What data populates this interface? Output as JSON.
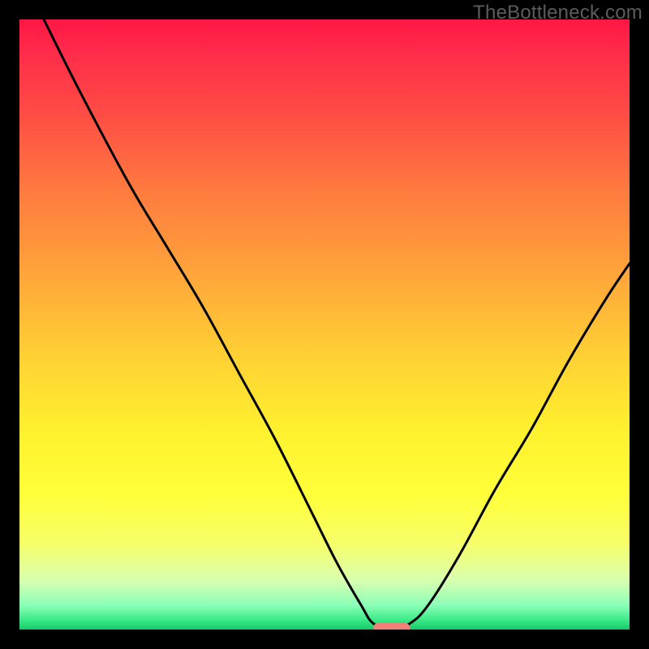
{
  "watermark": "TheBottleneck.com",
  "chart_data": {
    "type": "line",
    "title": "",
    "xlabel": "",
    "ylabel": "",
    "xlim": [
      0,
      100
    ],
    "ylim": [
      0,
      100
    ],
    "curve": [
      {
        "x": 4,
        "y": 100
      },
      {
        "x": 10,
        "y": 88
      },
      {
        "x": 18,
        "y": 73
      },
      {
        "x": 24,
        "y": 63
      },
      {
        "x": 30,
        "y": 53
      },
      {
        "x": 36,
        "y": 42
      },
      {
        "x": 42,
        "y": 31
      },
      {
        "x": 48,
        "y": 19
      },
      {
        "x": 52,
        "y": 11
      },
      {
        "x": 56,
        "y": 4
      },
      {
        "x": 58,
        "y": 1
      },
      {
        "x": 61,
        "y": 0
      },
      {
        "x": 64,
        "y": 1
      },
      {
        "x": 67,
        "y": 4
      },
      {
        "x": 72,
        "y": 12
      },
      {
        "x": 78,
        "y": 23
      },
      {
        "x": 84,
        "y": 33
      },
      {
        "x": 90,
        "y": 44
      },
      {
        "x": 96,
        "y": 54
      },
      {
        "x": 100,
        "y": 60
      }
    ],
    "optimal_marker": {
      "x_start": 58,
      "x_end": 64,
      "y": 0
    },
    "gradient_stops": [
      {
        "offset": 0.0,
        "color": "#ff1744"
      },
      {
        "offset": 0.05,
        "color": "#ff2a4a"
      },
      {
        "offset": 0.15,
        "color": "#ff4b45"
      },
      {
        "offset": 0.28,
        "color": "#ff7a3f"
      },
      {
        "offset": 0.42,
        "color": "#ffa63a"
      },
      {
        "offset": 0.55,
        "color": "#ffd034"
      },
      {
        "offset": 0.68,
        "color": "#fff22e"
      },
      {
        "offset": 0.78,
        "color": "#ffff3a"
      },
      {
        "offset": 0.86,
        "color": "#f7ff6a"
      },
      {
        "offset": 0.92,
        "color": "#d7ffb0"
      },
      {
        "offset": 0.96,
        "color": "#8cffb8"
      },
      {
        "offset": 0.985,
        "color": "#39e986"
      },
      {
        "offset": 1.0,
        "color": "#18c96a"
      }
    ],
    "marker_color": "#f08078"
  }
}
